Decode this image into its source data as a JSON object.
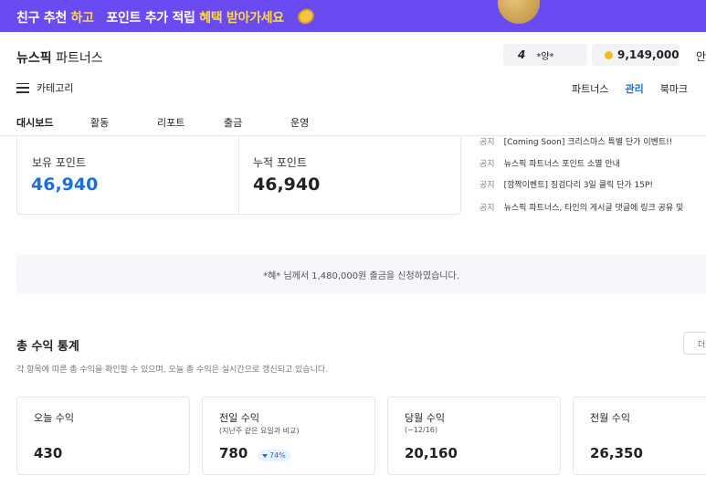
{
  "banner": {
    "part1": "친구 추천",
    "part2": "하고",
    "part3": "포인트 추가 적립",
    "part4": "혜택 받아가세요",
    "highlight_color": "#ffd84d",
    "background": "#6a4bf2"
  },
  "header": {
    "brand_bold": "뉴스픽",
    "brand_rest": " 파트너스",
    "user_level": "4",
    "user_name": "*양*",
    "points": "9,149,000",
    "right_cut": "안"
  },
  "category": {
    "label": "카테고리"
  },
  "topnav": {
    "items": [
      "파트너스",
      "관리",
      "북마크"
    ],
    "active": "관리"
  },
  "tabs": [
    "대시보드",
    "활동",
    "리포트",
    "출금",
    "운영"
  ],
  "points_card": {
    "held_label": "보유 포인트",
    "held_value": "46,940",
    "total_label": "누적 포인트",
    "total_value": "46,940"
  },
  "notices": [
    {
      "tag": "공지",
      "text": "[Coming Soon] 크리스마스 특별 단가 이벤트!!"
    },
    {
      "tag": "공지",
      "text": "뉴스픽 파트너스 포인트 소멸 안내"
    },
    {
      "tag": "공지",
      "text": "[깜짝이벤트] 징검다리 3일 클릭 단가 15P!"
    },
    {
      "tag": "공지",
      "text": "뉴스픽 파트너스, 타인의 게시글 댓글에 링크 공유 및"
    }
  ],
  "withdraw_notice": "*혜* 님께서 1,480,000원 출금을 신청하였습니다.",
  "stats": {
    "title": "총 수익 통계",
    "description": "각 항목에 따른 총 수익을 확인할 수 있으며, 오늘 총 수익은 실시간으로 갱신되고 있습니다.",
    "more_button": "더",
    "cards": [
      {
        "label": "오늘 수익",
        "sub": "",
        "value": "430",
        "badge": ""
      },
      {
        "label": "전일 수익",
        "sub": "(지난주 같은 요일과 비교)",
        "value": "780",
        "badge": "74%"
      },
      {
        "label": "당월 수익",
        "sub": "(~12/16)",
        "value": "20,160",
        "badge": ""
      },
      {
        "label": "전월 수익",
        "sub": "",
        "value": "26,350",
        "badge": ""
      }
    ]
  },
  "colors": {
    "accent": "#1a6ee0",
    "coin": "#f5b921"
  }
}
